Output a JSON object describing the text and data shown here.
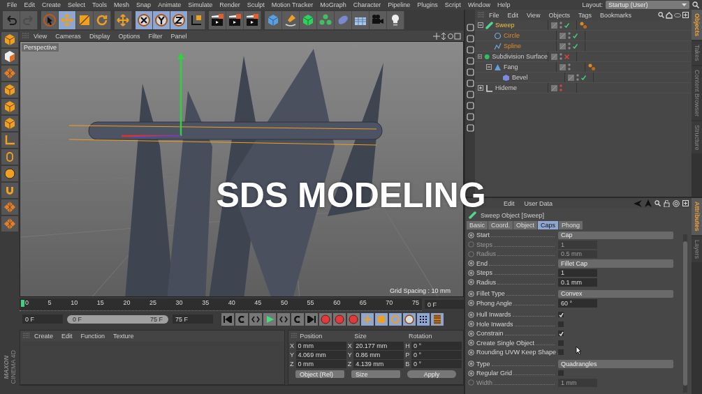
{
  "menu": [
    "File",
    "Edit",
    "Create",
    "Select",
    "Tools",
    "Mesh",
    "Snap",
    "Animate",
    "Simulate",
    "Render",
    "Sculpt",
    "Motion Tracker",
    "MoGraph",
    "Character",
    "Pipeline",
    "Plugins",
    "Script",
    "Window",
    "Help"
  ],
  "layout": {
    "label": "Layout:",
    "value": "Startup (User)"
  },
  "toolbar": [
    [
      {
        "selected": false,
        "disabled": false
      },
      {
        "selected": false,
        "disabled": true
      }
    ],
    [
      {
        "selected": false,
        "disabled": false
      },
      {
        "selected": true,
        "disabled": false
      },
      {
        "selected": false,
        "disabled": false
      },
      {
        "selected": false,
        "disabled": false
      }
    ],
    [
      {
        "selected": false,
        "disabled": false
      }
    ],
    [
      {
        "selected": true,
        "disabled": false
      },
      {
        "selected": true,
        "disabled": false
      },
      {
        "selected": true,
        "disabled": false
      },
      {
        "selected": false,
        "disabled": false
      }
    ],
    [
      {
        "selected": false,
        "disabled": false
      },
      {
        "selected": false,
        "disabled": false
      },
      {
        "selected": false,
        "disabled": false
      }
    ],
    [
      {
        "selected": false,
        "disabled": false
      },
      {
        "selected": false,
        "disabled": false
      },
      {
        "selected": false,
        "disabled": false
      },
      {
        "selected": false,
        "disabled": false
      },
      {
        "selected": false,
        "disabled": false
      },
      {
        "selected": false,
        "disabled": false
      },
      {
        "selected": false,
        "disabled": false
      },
      {
        "selected": false,
        "disabled": false
      }
    ]
  ],
  "viewport": {
    "menu": [
      "View",
      "Cameras",
      "Display",
      "Options",
      "Filter",
      "Panel"
    ],
    "camera": "Perspective",
    "grid_spacing": "Grid Spacing : 10 mm"
  },
  "overlay_title": "SDS MODELING",
  "timeline": {
    "ticks": [
      "0",
      "5",
      "10",
      "15",
      "20",
      "25",
      "30",
      "35",
      "40",
      "45",
      "50",
      "55",
      "60",
      "65",
      "70",
      "75"
    ],
    "current": "0 F",
    "start": "0 F",
    "range_start": "0 F",
    "range_end": "75 F",
    "end": "75 F"
  },
  "materials": {
    "menu": [
      "Create",
      "Edit",
      "Function",
      "Texture"
    ]
  },
  "coordinates": {
    "headers": [
      "Position",
      "Size",
      "Rotation"
    ],
    "rows": [
      {
        "axis": "X",
        "position": "0 mm",
        "size_axis": "X",
        "size": "20.177 mm",
        "rot_axis": "H",
        "rotation": "0 °"
      },
      {
        "axis": "Y",
        "position": "4.069 mm",
        "size_axis": "Y",
        "size": "0.86 mm",
        "rot_axis": "P",
        "rotation": "0 °"
      },
      {
        "axis": "Z",
        "position": "0 mm",
        "size_axis": "Z",
        "size": "4.139 mm",
        "rot_axis": "B",
        "rotation": "0 °"
      }
    ],
    "mode": "Object (Rel)",
    "size_mode": "Size",
    "apply": "Apply"
  },
  "brand": [
    "MAXON",
    "CINEMA 4D"
  ],
  "objects_panel": {
    "menu": [
      "File",
      "Edit",
      "View",
      "Objects",
      "Tags",
      "Bookmarks"
    ],
    "objects": [
      {
        "name": "Sweep",
        "kind": "sweep",
        "selected": true,
        "expanded": true,
        "hidden": false,
        "enabled": true,
        "tag": true,
        "children": [
          {
            "name": "Circle",
            "kind": "circle",
            "selected": true,
            "hidden": false,
            "enabled": true,
            "tag": false
          },
          {
            "name": "Spline",
            "kind": "spline",
            "selected": true,
            "hidden": false,
            "enabled": true,
            "tag": false
          }
        ]
      },
      {
        "name": "Subdivision Surface",
        "kind": "subdivision",
        "selected": false,
        "expanded": true,
        "hidden": false,
        "enabled": false,
        "tag": false,
        "children": [
          {
            "name": "Fang",
            "kind": "polygon",
            "selected": false,
            "expanded": true,
            "hidden": false,
            "tag": true,
            "children": [
              {
                "name": "Bevel",
                "kind": "bevel",
                "selected": false,
                "hidden": false,
                "enabled": true,
                "tag": false
              }
            ]
          }
        ]
      },
      {
        "name": "Hideme",
        "kind": "null",
        "selected": false,
        "expanded": false,
        "hidden": true,
        "tag": false
      }
    ]
  },
  "side_tabs_top": [
    {
      "label": "Objects",
      "selected": true
    },
    {
      "label": "Takes",
      "selected": false
    },
    {
      "label": "Content Browser",
      "selected": false
    },
    {
      "label": "Structure",
      "selected": false
    }
  ],
  "side_tabs_bottom": [
    {
      "label": "Attributes",
      "selected": true
    },
    {
      "label": "Layers",
      "selected": false
    }
  ],
  "attributes": {
    "menu": [
      "Edit",
      "User Data"
    ],
    "object": "Sweep Object [Sweep]",
    "tabs": [
      {
        "label": "Basic",
        "selected": false
      },
      {
        "label": "Coord.",
        "selected": false
      },
      {
        "label": "Object",
        "selected": false
      },
      {
        "label": "Caps",
        "selected": true
      },
      {
        "label": "Phong",
        "selected": false
      }
    ],
    "groups": [
      [
        {
          "kind": "dropdown",
          "label": "Start",
          "value": "Cap",
          "disabled": false
        },
        {
          "kind": "number",
          "label": "Steps",
          "value": "1",
          "disabled": true
        },
        {
          "kind": "number",
          "label": "Radius",
          "value": "0.5 mm",
          "disabled": true
        },
        {
          "kind": "dropdown",
          "label": "End",
          "value": "Fillet Cap",
          "disabled": false
        },
        {
          "kind": "number",
          "label": "Steps",
          "value": "1",
          "disabled": false
        },
        {
          "kind": "number",
          "label": "Radius",
          "value": "0.1 mm",
          "disabled": false
        }
      ],
      [
        {
          "kind": "dropdown",
          "label": "Fillet Type",
          "value": "Convex",
          "disabled": false
        },
        {
          "kind": "number",
          "label": "Phong Angle",
          "value": "60 °",
          "disabled": false
        }
      ],
      [
        {
          "kind": "checkbox",
          "label": "Hull Inwards",
          "checked": true,
          "disabled": false
        },
        {
          "kind": "checkbox",
          "label": "Hole Inwards",
          "checked": false,
          "disabled": false
        },
        {
          "kind": "checkbox",
          "label": "Constrain",
          "checked": true,
          "disabled": false
        },
        {
          "kind": "checkbox",
          "label": "Create Single Object",
          "checked": false,
          "disabled": false
        },
        {
          "kind": "checkbox",
          "label": "Rounding UVW Keep Shape",
          "checked": false,
          "disabled": false
        }
      ],
      [
        {
          "kind": "dropdown",
          "label": "Type",
          "value": "Quadrangles",
          "disabled": false
        },
        {
          "kind": "checkbox",
          "label": "Regular Grid",
          "checked": false,
          "disabled": false
        },
        {
          "kind": "number",
          "label": "Width",
          "value": "1 mm",
          "disabled": true
        }
      ]
    ]
  }
}
